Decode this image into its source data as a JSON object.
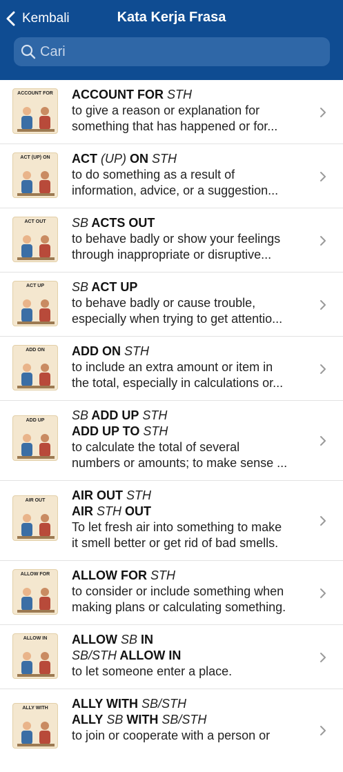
{
  "nav": {
    "back_label": "Kembali",
    "title": "Kata Kerja Frasa"
  },
  "search": {
    "placeholder": "Cari"
  },
  "entries": [
    {
      "thumb": "ACCOUNT FOR",
      "heads": [
        [
          [
            "b",
            "ACCOUNT FOR"
          ],
          [
            "i",
            " STH"
          ]
        ]
      ],
      "def": [
        "to give a reason or explanation for",
        "something that has happened or for..."
      ]
    },
    {
      "thumb": "ACT (UP) ON",
      "heads": [
        [
          [
            "b",
            "ACT"
          ],
          [
            "i",
            " (UP)"
          ],
          [
            "b",
            " ON"
          ],
          [
            "i",
            " STH"
          ]
        ]
      ],
      "def": [
        "to do something as a result of",
        "information, advice, or a suggestion..."
      ]
    },
    {
      "thumb": "ACT OUT",
      "heads": [
        [
          [
            "i",
            "SB"
          ],
          [
            "b",
            " ACTS OUT"
          ]
        ]
      ],
      "def": [
        "to behave badly or show your feelings",
        "through inappropriate or disruptive..."
      ]
    },
    {
      "thumb": "ACT UP",
      "heads": [
        [
          [
            "i",
            "SB"
          ],
          [
            "b",
            " ACT UP"
          ]
        ]
      ],
      "def": [
        "to behave badly or cause trouble,",
        "especially when trying to get attentio..."
      ]
    },
    {
      "thumb": "ADD ON",
      "heads": [
        [
          [
            "b",
            "ADD ON"
          ],
          [
            "i",
            " STH"
          ]
        ]
      ],
      "def": [
        "to include an extra amount or item in",
        "the total, especially in calculations or..."
      ]
    },
    {
      "thumb": "ADD UP",
      "heads": [
        [
          [
            "i",
            "SB"
          ],
          [
            "b",
            " ADD UP"
          ],
          [
            "i",
            " STH"
          ]
        ],
        [
          [
            "b",
            "ADD UP TO"
          ],
          [
            "i",
            " STH"
          ]
        ]
      ],
      "def": [
        "to calculate the total of several",
        "numbers or amounts; to make sense ..."
      ]
    },
    {
      "thumb": "AIR OUT",
      "heads": [
        [
          [
            "b",
            "AIR OUT"
          ],
          [
            "i",
            " STH"
          ]
        ],
        [
          [
            "b",
            "AIR"
          ],
          [
            "i",
            " STH"
          ],
          [
            "b",
            " OUT"
          ]
        ]
      ],
      "def": [
        "To let fresh air into something to make",
        "it smell better or get rid of bad smells."
      ]
    },
    {
      "thumb": "ALLOW FOR",
      "heads": [
        [
          [
            "b",
            "ALLOW FOR"
          ],
          [
            "i",
            " STH"
          ]
        ]
      ],
      "def": [
        "to consider or include something when",
        "making plans or calculating something."
      ]
    },
    {
      "thumb": "ALLOW IN",
      "heads": [
        [
          [
            "b",
            "ALLOW"
          ],
          [
            "i",
            " SB"
          ],
          [
            "b",
            " IN"
          ]
        ],
        [
          [
            "i",
            "SB/STH"
          ],
          [
            "b",
            " ALLOW IN"
          ]
        ]
      ],
      "def": [
        "to let someone enter a place."
      ]
    },
    {
      "thumb": "ALLY WITH",
      "heads": [
        [
          [
            "b",
            "ALLY WITH"
          ],
          [
            "i",
            " SB/STH"
          ]
        ],
        [
          [
            "b",
            "ALLY"
          ],
          [
            "i",
            " SB"
          ],
          [
            "b",
            " WITH"
          ],
          [
            "i",
            " SB/STH"
          ]
        ]
      ],
      "def": [
        "to join or cooperate with a person or"
      ]
    }
  ]
}
